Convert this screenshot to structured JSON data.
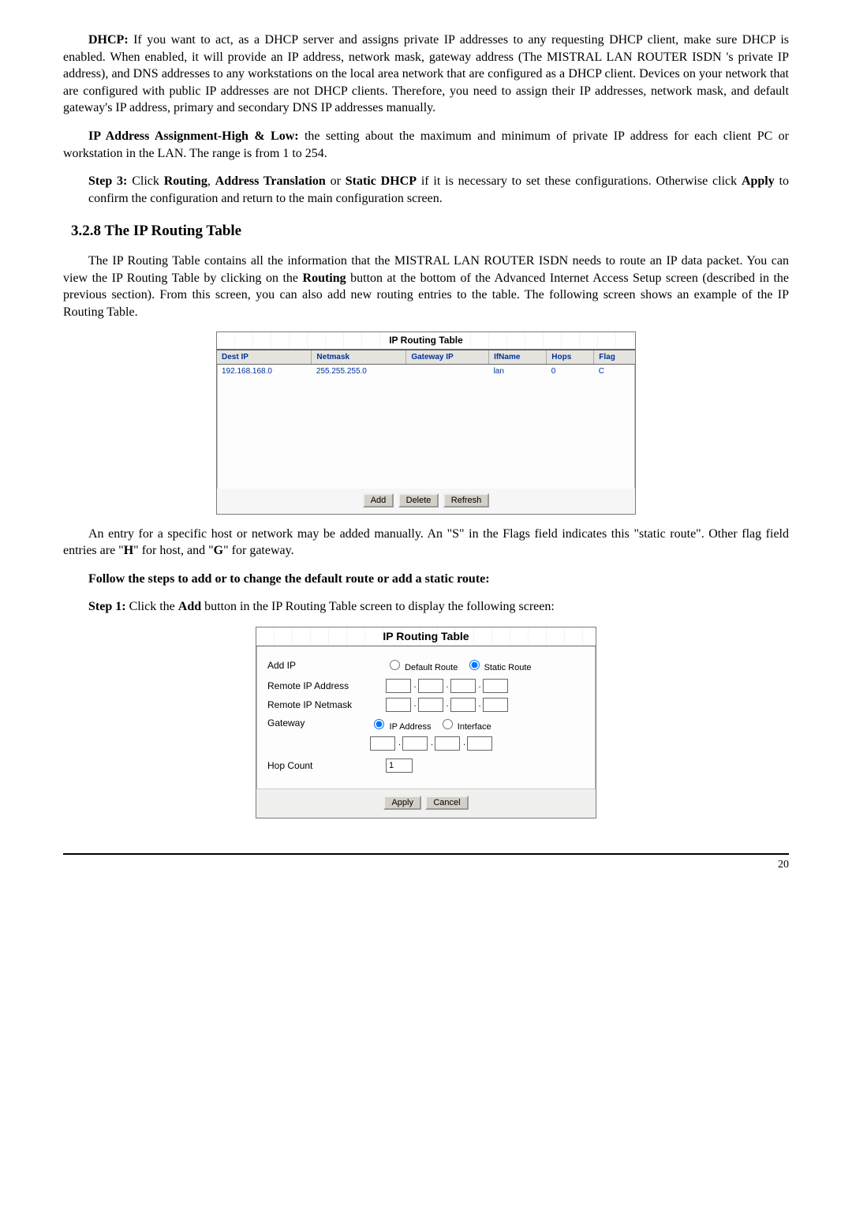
{
  "paras": {
    "dhcp_label": "DHCP:",
    "dhcp_body": " If you want to act, as a DHCP server and assigns private IP addresses to any requesting DHCP client, make sure DHCP is enabled. When enabled, it will provide an IP address, network mask, gateway address (The MISTRAL LAN ROUTER ISDN 's private IP address), and DNS addresses to any workstations on the local area network that are configured as a DHCP client. Devices on your network that are configured with public IP addresses are not DHCP clients. Therefore, you need to assign their IP addresses, network mask, and default gateway's IP address, primary and secondary DNS IP addresses manually.",
    "ipa_label": "IP Address Assignment-High & Low:",
    "ipa_body": " the setting about the maximum and minimum of private IP address for each client PC or workstation in the LAN. The range is from 1 to 254.",
    "step3_label": "Step 3:",
    "step3_b1": " Click ",
    "step3_b2": "Routing",
    "step3_b3": ", ",
    "step3_b4": "Address Translation",
    "step3_b5": " or ",
    "step3_b6": "Static DHCP",
    "step3_b7": " if it is necessary to set these configurations. Otherwise click ",
    "step3_b8": "Apply",
    "step3_b9": " to confirm the configuration and return to the main configuration screen."
  },
  "section_heading": "3.2.8 The IP Routing Table",
  "section_intro": "The IP Routing Table contains all the information that the MISTRAL LAN ROUTER ISDN needs to route an IP data packet. You can view the IP Routing Table by clicking on the ",
  "section_intro_b": "Routing",
  "section_intro_tail": " button at the bottom of the Advanced Internet Access Setup screen (described in the previous section). From this screen, you can also add new routing entries to the table. The following screen shows an example of the IP Routing Table.",
  "rt1": {
    "title": "IP Routing Table",
    "headers": [
      "Dest IP",
      "Netmask",
      "Gateway IP",
      "IfName",
      "Hops",
      "Flag"
    ],
    "row": {
      "dest": "192.168.168.0",
      "mask": "255.255.255.0",
      "gw": "",
      "if": "lan",
      "hops": "0",
      "flag": "C"
    },
    "buttons": {
      "add": "Add",
      "del": "Delete",
      "ref": "Refresh"
    }
  },
  "entry_para1": "An entry for a specific host or network may be added manually. An \"S\" in the Flags field indicates this \"static route\". Other flag field entries are \"",
  "entry_para_H": "H",
  "entry_para2": "\" for host, and \"",
  "entry_para_G": "G",
  "entry_para3": "\" for gateway.",
  "follow_heading": "Follow the steps to add or to change the default route or add a static route:",
  "step1_label": "Step 1:",
  "step1_b1": " Click the ",
  "step1_b2": "Add",
  "step1_b3": " button in the IP Routing Table screen to display the following screen:",
  "rt2": {
    "title": "IP Routing Table",
    "rows": {
      "addip": "Add IP",
      "raddr": "Remote IP Address",
      "rmask": "Remote IP Netmask",
      "gw": "Gateway",
      "hop": "Hop Count"
    },
    "radios": {
      "def": "Default Route",
      "stat": "Static Route",
      "ipa": "IP Address",
      "ifc": "Interface"
    },
    "hop_value": "1",
    "buttons": {
      "apply": "Apply",
      "cancel": "Cancel"
    }
  },
  "page_number": "20"
}
